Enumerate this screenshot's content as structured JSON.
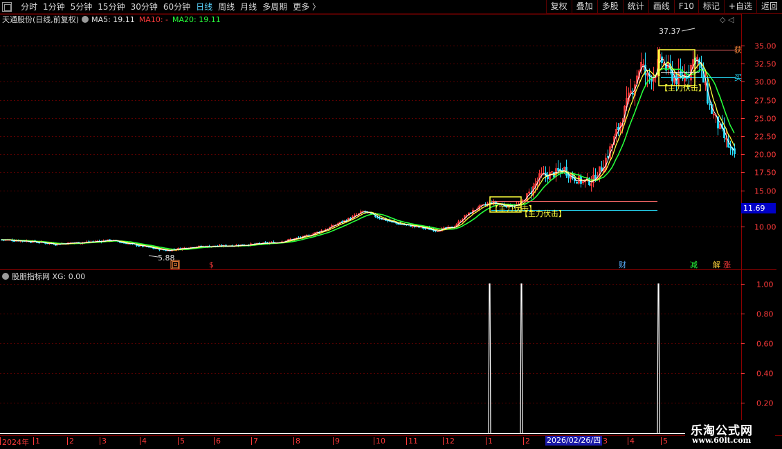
{
  "toolbar": {
    "periods": [
      {
        "label": "分时",
        "active": false
      },
      {
        "label": "1分钟",
        "active": false
      },
      {
        "label": "5分钟",
        "active": false
      },
      {
        "label": "15分钟",
        "active": false
      },
      {
        "label": "30分钟",
        "active": false
      },
      {
        "label": "60分钟",
        "active": false
      },
      {
        "label": "日线",
        "active": true
      },
      {
        "label": "周线",
        "active": false
      },
      {
        "label": "月线",
        "active": false
      },
      {
        "label": "多周期",
        "active": false
      },
      {
        "label": "更多 〉",
        "active": false
      }
    ],
    "tools": [
      "复权",
      "叠加",
      "多股",
      "统计",
      "画线",
      "F10",
      "标记",
      "+自选",
      "返回"
    ]
  },
  "legend": {
    "stock": "天通股份(日线,前复权)",
    "ma5": "MA5: 19.11",
    "ma10": "MA10: -",
    "ma20": "MA20: 19.11",
    "tools": "◇  ◁"
  },
  "indicator": {
    "label": "股朋指标网 XG: 0.00"
  },
  "price_axis": {
    "ticks": [
      "35.00",
      "32.50",
      "30.00",
      "27.50",
      "25.00",
      "22.50",
      "20.00",
      "17.50",
      "15.00",
      "10.00"
    ],
    "last_price": "11.69"
  },
  "indicator_axis": {
    "ticks": [
      "1.00",
      "0.80",
      "0.60",
      "0.40",
      "0.20"
    ]
  },
  "annotations": {
    "high": "37.37",
    "low": "5.88",
    "signal_1": "【主力伏击】",
    "signal_2": "【主力伏击】",
    "signal_3": "【主力伏击】",
    "sell": "获",
    "buy": "买",
    "event_hui": "回",
    "event_s": "$",
    "event_cai": "财",
    "event_jian": "减",
    "event_zhang": "涨",
    "event_jie": "解"
  },
  "date_axis": {
    "labels": [
      "2024年",
      "1",
      "2",
      "3",
      "4",
      "5",
      "6",
      "7",
      "8",
      "9",
      "10",
      "11",
      "12",
      "1",
      "2",
      "3",
      "4",
      "5",
      "6"
    ],
    "cursor": "2026/02/26/四"
  },
  "watermark": {
    "title": "乐淘公式网",
    "url": "www.60lt.com"
  },
  "colors": {
    "up": "#ff3b3b",
    "down": "#27e0ff",
    "ma5": "#ffffff",
    "ma10": "#ffff3c",
    "ma20": "#27ff3b",
    "grid": "#5a0000",
    "signal": "#ffff3c"
  },
  "chart_data": {
    "type": "table",
    "symbol": "天通股份",
    "period": "日线",
    "adjust": "前复权",
    "ylim": [
      5,
      38
    ],
    "yticks": [
      35.0,
      32.5,
      30.0,
      27.5,
      25.0,
      22.5,
      20.0,
      17.5,
      15.0,
      10.0
    ],
    "last_price": 11.69,
    "high": 37.37,
    "low": 5.88,
    "ma5": 19.11,
    "ma20": 19.11,
    "price_path": [
      [
        0,
        8.2
      ],
      [
        40,
        8.0
      ],
      [
        80,
        7.6
      ],
      [
        120,
        7.8
      ],
      [
        160,
        8.1
      ],
      [
        200,
        7.4
      ],
      [
        240,
        6.7
      ],
      [
        280,
        7.2
      ],
      [
        320,
        7.3
      ],
      [
        360,
        7.5
      ],
      [
        400,
        7.8
      ],
      [
        440,
        8.6
      ],
      [
        470,
        9.6
      ],
      [
        490,
        10.5
      ],
      [
        510,
        11.3
      ],
      [
        525,
        12.1
      ],
      [
        545,
        11.3
      ],
      [
        570,
        10.5
      ],
      [
        600,
        10.0
      ],
      [
        630,
        9.5
      ],
      [
        655,
        9.9
      ],
      [
        670,
        11.3
      ],
      [
        690,
        12.6
      ],
      [
        710,
        13.3
      ],
      [
        730,
        12.9
      ],
      [
        750,
        13.0
      ],
      [
        765,
        14.6
      ],
      [
        780,
        16.9
      ],
      [
        800,
        17.3
      ],
      [
        815,
        17.9
      ],
      [
        825,
        17.0
      ],
      [
        840,
        16.2
      ],
      [
        855,
        16.3
      ],
      [
        870,
        18.2
      ],
      [
        885,
        21.6
      ],
      [
        900,
        25.4
      ],
      [
        915,
        29.5
      ],
      [
        925,
        32.5
      ],
      [
        935,
        30.5
      ],
      [
        945,
        31.3
      ],
      [
        955,
        33.0
      ],
      [
        965,
        31.5
      ],
      [
        980,
        30.2
      ],
      [
        995,
        31.5
      ],
      [
        1005,
        33.8
      ],
      [
        1015,
        30.5
      ],
      [
        1025,
        26.6
      ],
      [
        1040,
        23.4
      ],
      [
        1050,
        21.5
      ],
      [
        1062,
        19.3
      ]
    ],
    "indicator": {
      "name": "XG",
      "ylim": [
        0,
        1.05
      ],
      "yticks": [
        1.0,
        0.8,
        0.6,
        0.4,
        0.2
      ],
      "current": 0.0,
      "signals_at_date_axis": [
        "between 1 and 2",
        "2",
        "6"
      ]
    }
  }
}
